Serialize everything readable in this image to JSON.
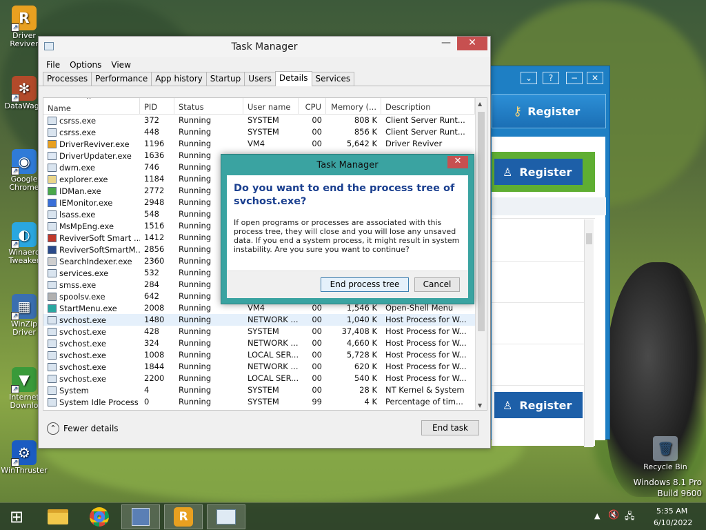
{
  "desktop": {
    "icons": [
      {
        "label": "Driver\nReviver",
        "color": "#e8a020",
        "glyph": "R"
      },
      {
        "label": "DataWago",
        "color": "#b24a2a",
        "glyph": "✻"
      },
      {
        "label": "Google\nChrome",
        "color": "#2f7bd8",
        "glyph": "◉"
      },
      {
        "label": "Winaero\nTweaker",
        "color": "#2aa7e0",
        "glyph": "◐"
      },
      {
        "label": "WinZip\nDriver",
        "color": "#3a6fb0",
        "glyph": "▦"
      },
      {
        "label": "Internet\nDownlo",
        "color": "#3a9a3a",
        "glyph": "▼"
      },
      {
        "label": "WinThruster",
        "color": "#1b5cc2",
        "glyph": "⚙"
      }
    ],
    "recycle_bin": "Recycle Bin",
    "os_watermark": "Windows 8.1 Pro",
    "build_watermark": "Build 9600"
  },
  "bg_app": {
    "register_top": "Register",
    "register_mid": "Register",
    "register_bottom": "Register",
    "help_glyph": "?",
    "min_glyph": "−",
    "close_glyph": "✕"
  },
  "task_manager": {
    "title": "Task Manager",
    "min_glyph": "—",
    "close_glyph": "✕",
    "menu": [
      "File",
      "Options",
      "View"
    ],
    "tabs": [
      "Processes",
      "Performance",
      "App history",
      "Startup",
      "Users",
      "Details",
      "Services"
    ],
    "active_tab": "Details",
    "columns": [
      "Name",
      "PID",
      "Status",
      "User name",
      "CPU",
      "Memory (...",
      "Description"
    ],
    "sort_indicator": "^",
    "rows": [
      [
        "csrss.exe",
        "372",
        "Running",
        "SYSTEM",
        "00",
        "808 K",
        "Client Server Runt..."
      ],
      [
        "csrss.exe",
        "448",
        "Running",
        "SYSTEM",
        "00",
        "856 K",
        "Client Server Runt..."
      ],
      [
        "DriverReviver.exe",
        "1196",
        "Running",
        "VM4",
        "00",
        "5,642 K",
        "Driver Reviver"
      ],
      [
        "DriverUpdater.exe",
        "1636",
        "Running",
        "",
        "",
        "",
        ""
      ],
      [
        "dwm.exe",
        "746",
        "Running",
        "",
        "",
        "",
        ""
      ],
      [
        "explorer.exe",
        "1184",
        "Running",
        "",
        "",
        "",
        ""
      ],
      [
        "IDMan.exe",
        "2772",
        "Running",
        "",
        "",
        "",
        ""
      ],
      [
        "IEMonitor.exe",
        "2948",
        "Running",
        "",
        "",
        "",
        ""
      ],
      [
        "lsass.exe",
        "548",
        "Running",
        "",
        "",
        "",
        ""
      ],
      [
        "MsMpEng.exe",
        "1516",
        "Running",
        "",
        "",
        "",
        ""
      ],
      [
        "ReviverSoft Smart ...",
        "1412",
        "Running",
        "",
        "",
        "",
        ""
      ],
      [
        "ReviverSoftSmartM...",
        "2856",
        "Running",
        "",
        "",
        "",
        ""
      ],
      [
        "SearchIndexer.exe",
        "2360",
        "Running",
        "",
        "",
        "",
        ""
      ],
      [
        "services.exe",
        "532",
        "Running",
        "",
        "",
        "",
        ""
      ],
      [
        "smss.exe",
        "284",
        "Running",
        "",
        "",
        "",
        ""
      ],
      [
        "spoolsv.exe",
        "642",
        "Running",
        "",
        "",
        "",
        ""
      ],
      [
        "StartMenu.exe",
        "2008",
        "Running",
        "VM4",
        "00",
        "1,546 K",
        "Open-Shell Menu"
      ],
      [
        "svchost.exe",
        "1480",
        "Running",
        "NETWORK ...",
        "00",
        "1,040 K",
        "Host Process for W..."
      ],
      [
        "svchost.exe",
        "428",
        "Running",
        "SYSTEM",
        "00",
        "37,408 K",
        "Host Process for W..."
      ],
      [
        "svchost.exe",
        "324",
        "Running",
        "NETWORK ...",
        "00",
        "4,660 K",
        "Host Process for W..."
      ],
      [
        "svchost.exe",
        "1008",
        "Running",
        "LOCAL SER...",
        "00",
        "5,728 K",
        "Host Process for W..."
      ],
      [
        "svchost.exe",
        "1844",
        "Running",
        "NETWORK ...",
        "00",
        "620 K",
        "Host Process for W..."
      ],
      [
        "svchost.exe",
        "2200",
        "Running",
        "LOCAL SER...",
        "00",
        "540 K",
        "Host Process for W..."
      ],
      [
        "System",
        "4",
        "Running",
        "SYSTEM",
        "00",
        "28 K",
        "NT Kernel & System"
      ],
      [
        "System Idle Process",
        "0",
        "Running",
        "SYSTEM",
        "99",
        "4 K",
        "Percentage of tim..."
      ]
    ],
    "selected_row": 17,
    "fewer_details": "Fewer details",
    "end_task": "End task"
  },
  "dialog": {
    "title": "Task Manager",
    "close_glyph": "✕",
    "heading": "Do you want to end the process tree of svchost.exe?",
    "body": "If open programs or processes are associated with this process tree, they will close and you will lose any unsaved data. If you end a system process, it might result in system instability. Are you sure you want to continue?",
    "primary_button": "End process tree",
    "cancel_button": "Cancel"
  },
  "taskbar": {
    "start_glyph": "⊞",
    "time": "5:35 AM",
    "date": "6/10/2022"
  }
}
